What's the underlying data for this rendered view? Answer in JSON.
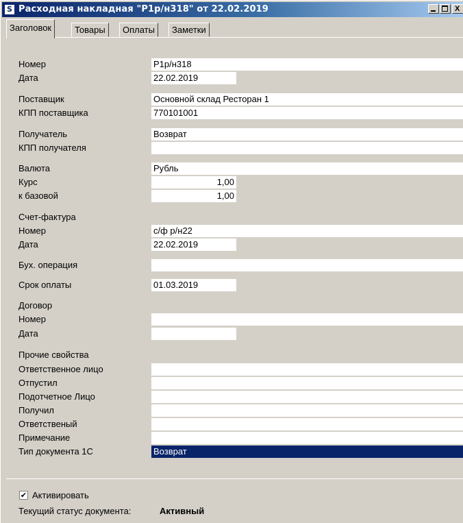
{
  "window": {
    "app_icon": "S",
    "title": "Расходная накладная \"Р1р/н318\" от 22.02.2019",
    "close_glyph": "X"
  },
  "tabs": [
    "Заголовок",
    "Товары",
    "Оплаты",
    "Заметки"
  ],
  "fields": {
    "nomer": {
      "label": "Номер",
      "value": "Р1р/н318"
    },
    "data": {
      "label": "Дата",
      "value": "22.02.2019"
    },
    "postavshik": {
      "label": "Поставщик",
      "value": "Основной склад Ресторан 1"
    },
    "kpp_postavshika": {
      "label": "КПП поставщика",
      "value": "770101001"
    },
    "poluchatel": {
      "label": "Получатель",
      "value": "Возврат"
    },
    "kpp_poluchatelya": {
      "label": "КПП получателя",
      "value": ""
    },
    "valyuta": {
      "label": "Валюта",
      "value": "Рубль"
    },
    "kurs": {
      "label": "Курс",
      "value": "1,00"
    },
    "k_bazovoy": {
      "label": "к базовой",
      "value": "1,00"
    },
    "schet_faktura": {
      "label": "Счет-фактура"
    },
    "sf_nomer": {
      "label": "Номер",
      "value": "с/ф р/н22"
    },
    "sf_data": {
      "label": "Дата",
      "value": "22.02.2019"
    },
    "buh_operaciya": {
      "label": "Бух. операция",
      "value": ""
    },
    "srok_oplaty": {
      "label": "Срок оплаты",
      "value": "01.03.2019"
    },
    "dogovor": {
      "label": "Договор"
    },
    "dog_nomer": {
      "label": "Номер",
      "value": ""
    },
    "dog_data": {
      "label": "Дата",
      "value": ""
    },
    "prochie": {
      "label": "Прочие свойства"
    },
    "otv_lico": {
      "label": "Ответственное лицо",
      "value": ""
    },
    "otpustil": {
      "label": "Отпустил",
      "value": ""
    },
    "podotchetnoe": {
      "label": "Подотчетное Лицо",
      "value": ""
    },
    "poluchil": {
      "label": "Получил",
      "value": ""
    },
    "otvetstveniy": {
      "label": "Ответственый",
      "value": ""
    },
    "primechanie": {
      "label": "Примечание",
      "value": ""
    },
    "tip_1c": {
      "label": "Тип документа 1С",
      "value": "Возврат"
    }
  },
  "activate": {
    "label": "Активировать",
    "checked": true,
    "mark": "✔"
  },
  "status": {
    "label": "Текущий статус документа:",
    "value": "Активный"
  }
}
